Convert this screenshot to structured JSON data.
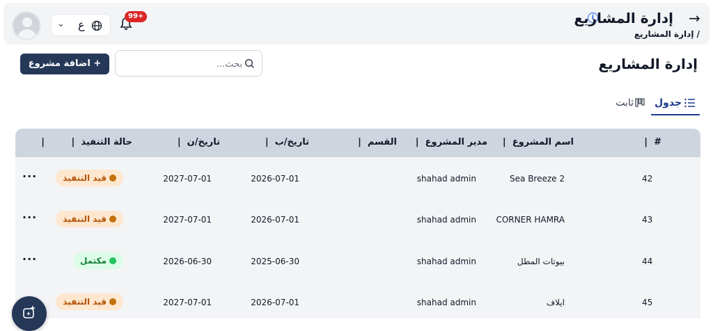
{
  "header": {
    "title": "إدارة المشاريع",
    "breadcrumb": "/ إدارة المشاريع",
    "notification_badge": "99+",
    "language_code": "ع"
  },
  "toolbar": {
    "page_title": "إدارة المشاريع",
    "search_placeholder": "بحث...",
    "add_button_label": "اضافة مشروع +"
  },
  "tabs": [
    {
      "label": "جدول",
      "active": true
    },
    {
      "label": "ثابت",
      "active": false
    }
  ],
  "table": {
    "columns": [
      "#",
      "اسم المشروع",
      "مدير المشروع",
      "القسم",
      "تاريخ/ب",
      "تاريخ/ن",
      "حالة التنفيذ",
      ""
    ],
    "rows": [
      {
        "id": "42",
        "name": "Sea Breeze 2",
        "manager": "shahad admin",
        "department": "",
        "start": "2026-07-01",
        "end": "2027-07-01",
        "status": "قيد التنفيذ",
        "status_type": "in-progress"
      },
      {
        "id": "43",
        "name": "CORNER HAMRA",
        "manager": "shahad admin",
        "department": "",
        "start": "2026-07-01",
        "end": "2027-07-01",
        "status": "قيد التنفيذ",
        "status_type": "in-progress"
      },
      {
        "id": "44",
        "name": "بيوتات المطل",
        "manager": "shahad admin",
        "department": "",
        "start": "2025-06-30",
        "end": "2026-06-30",
        "status": "مكتمل",
        "status_type": "done"
      },
      {
        "id": "45",
        "name": "ايلاف",
        "manager": "shahad admin",
        "department": "",
        "start": "2026-07-01",
        "end": "2027-07-01",
        "status": "قيد التنفيذ",
        "status_type": "in-progress"
      }
    ],
    "row_menu": "···"
  },
  "colors": {
    "primary": "#253858",
    "header_bg": "#cfd5df",
    "badge": "#dc2626",
    "in_progress": "#c2710c",
    "done": "#22c55e"
  },
  "icons": [
    "user-avatar",
    "chevron-down-icon",
    "globe-icon",
    "bell-icon",
    "info-icon",
    "arrow-right-icon",
    "search-icon",
    "list-icon",
    "columns-icon",
    "ai-sparkle-icon"
  ]
}
